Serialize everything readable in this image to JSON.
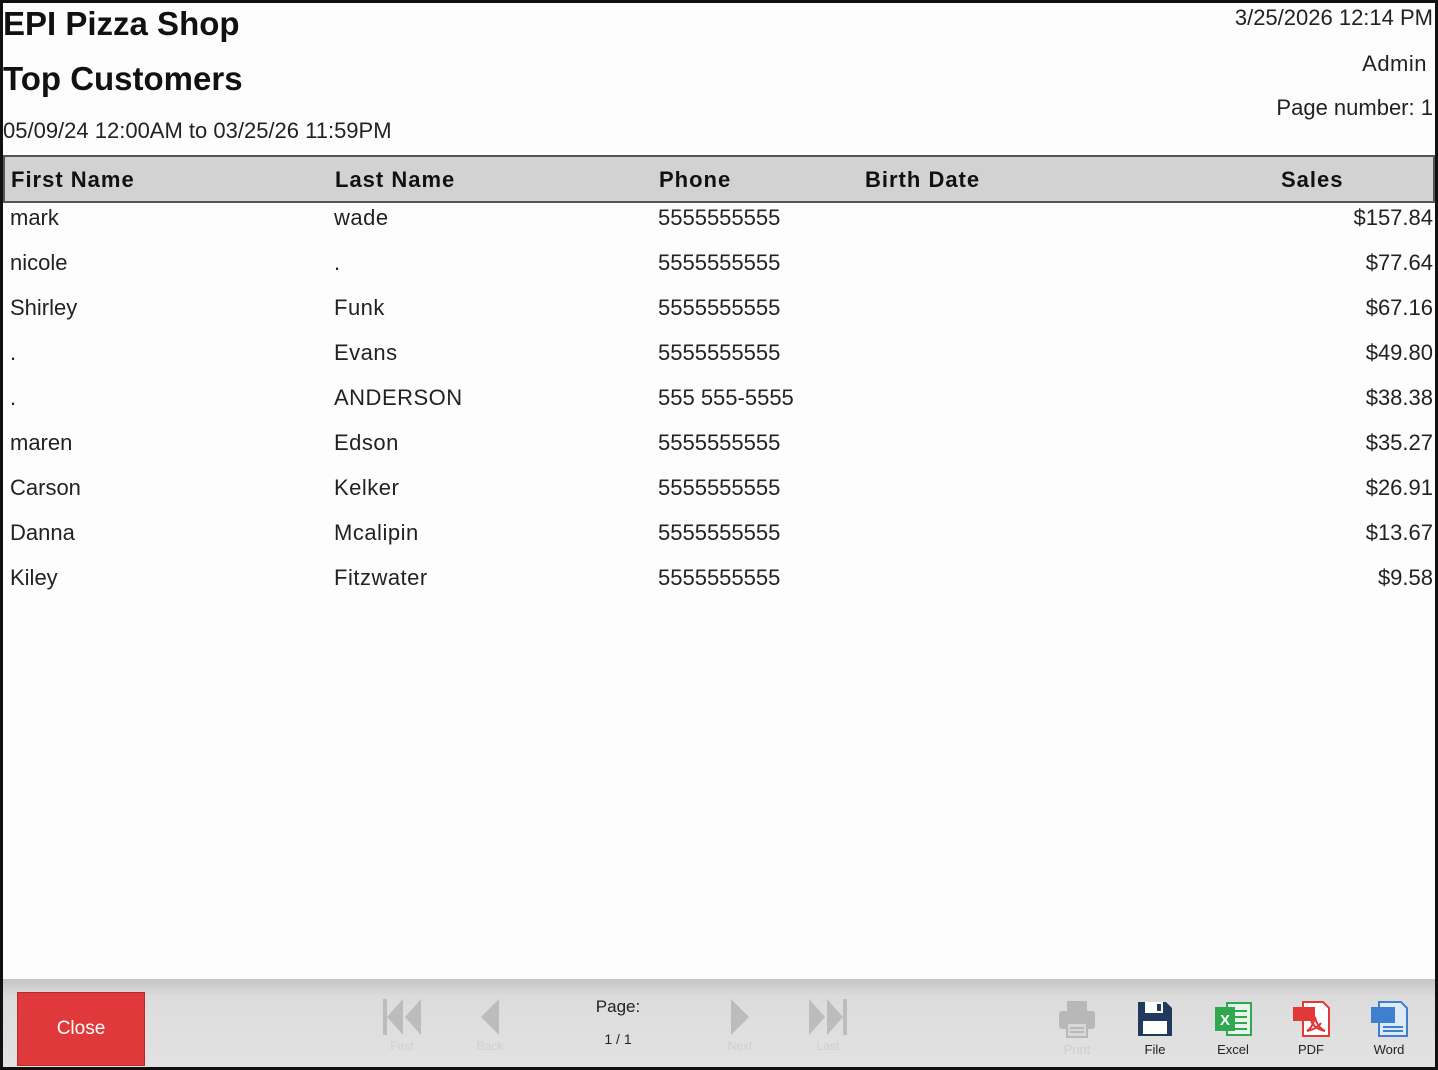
{
  "header": {
    "shop_name": "EPI Pizza Shop",
    "report_title": "Top Customers",
    "date_range": "05/09/24 12:00AM to 03/25/26 11:59PM",
    "print_datetime": "3/25/2026 12:14 PM",
    "user": "Admin",
    "page_number_label": "Page number:",
    "page_number_value": "1"
  },
  "table": {
    "columns": [
      "First Name",
      "Last Name",
      "Phone",
      "Birth Date",
      "Sales"
    ],
    "rows": [
      {
        "first": "mark",
        "last": "wade",
        "phone": "5555555555",
        "birth": "",
        "sales": "$157.84"
      },
      {
        "first": "nicole",
        "last": ".",
        "phone": "5555555555",
        "birth": "",
        "sales": "$77.64"
      },
      {
        "first": "Shirley",
        "last": "Funk",
        "phone": "5555555555",
        "birth": "",
        "sales": "$67.16"
      },
      {
        "first": ".",
        "last": "Evans",
        "phone": "5555555555",
        "birth": "",
        "sales": "$49.80"
      },
      {
        "first": ".",
        "last": "ANDERSON",
        "phone": "555 555-5555",
        "birth": "",
        "sales": "$38.38"
      },
      {
        "first": "maren",
        "last": "Edson",
        "phone": "5555555555",
        "birth": "",
        "sales": "$35.27"
      },
      {
        "first": "Carson",
        "last": "Kelker",
        "phone": "5555555555",
        "birth": "",
        "sales": "$26.91"
      },
      {
        "first": "Danna",
        "last": "Mcalipin",
        "phone": "5555555555",
        "birth": "",
        "sales": "$13.67"
      },
      {
        "first": "Kiley",
        "last": "Fitzwater",
        "phone": "5555555555",
        "birth": "",
        "sales": "$9.58"
      }
    ]
  },
  "toolbar": {
    "close_label": "Close",
    "first_label": "First",
    "back_label": "Back",
    "next_label": "Next",
    "last_label": "Last",
    "page_label": "Page:",
    "page_value": "1 / 1",
    "print_label": "Print",
    "file_label": "File",
    "excel_label": "Excel",
    "pdf_label": "PDF",
    "word_label": "Word"
  },
  "colors": {
    "close_button": "#e0393c",
    "header_bg": "#d2d2d2",
    "excel": "#2fa84f",
    "pdf": "#e2383a",
    "word": "#3f7fcf",
    "file": "#1f3a5c",
    "disabled": "#b8b8b8"
  },
  "icons": [
    "first-page-icon",
    "prev-page-icon",
    "next-page-icon",
    "last-page-icon",
    "printer-icon",
    "save-file-icon",
    "excel-icon",
    "pdf-icon",
    "word-icon"
  ]
}
